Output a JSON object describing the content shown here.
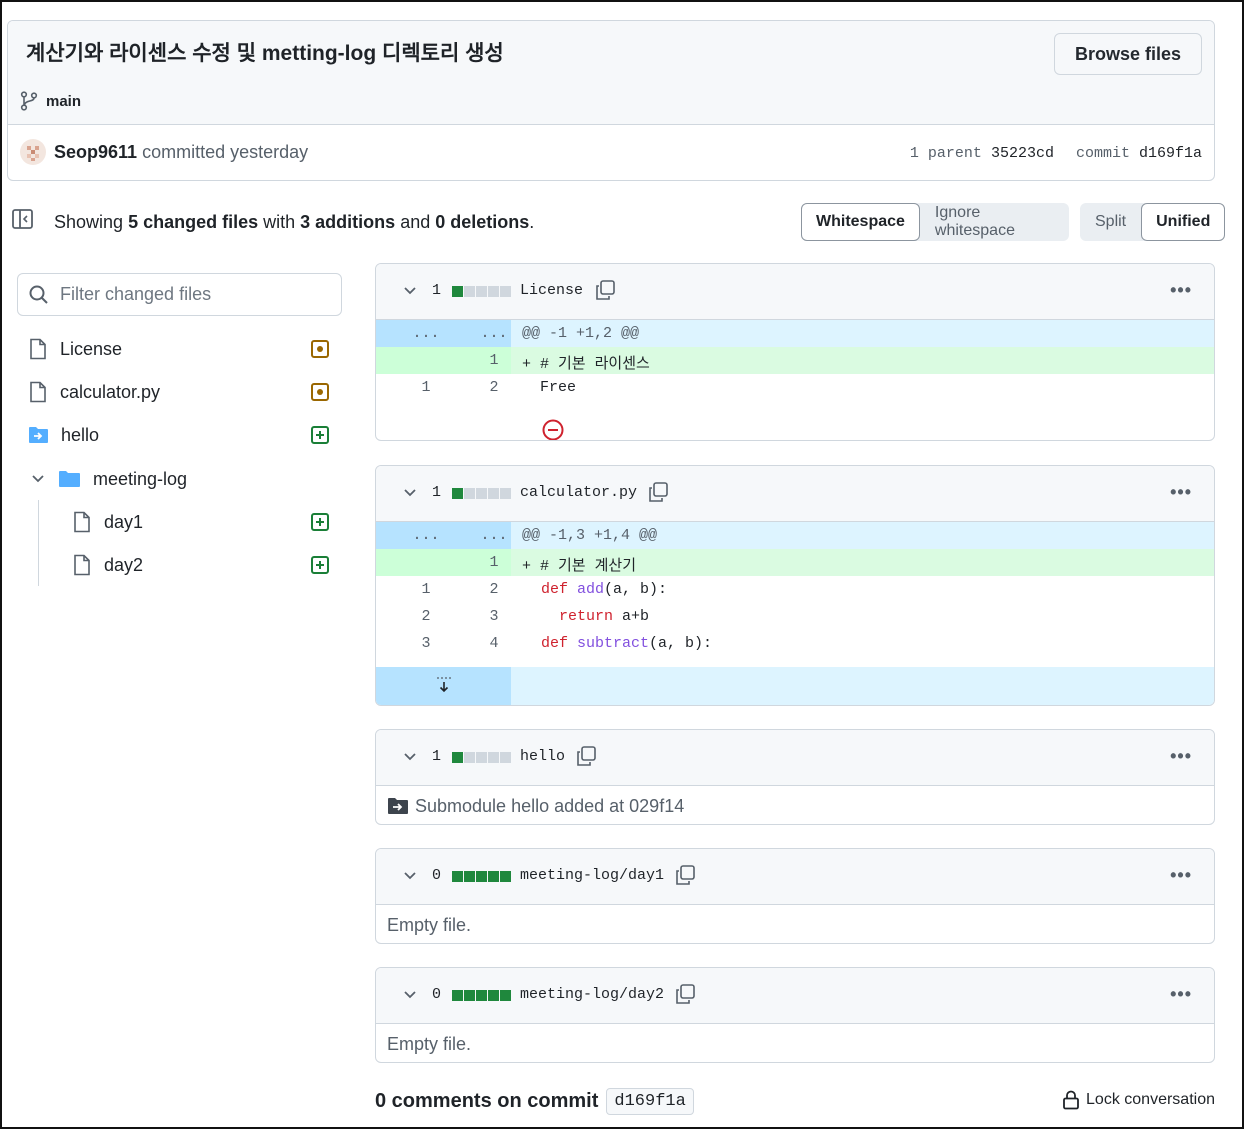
{
  "commit": {
    "title": "계산기와 라이센스 수정 및 metting-log 디렉토리 생성",
    "browse_label": "Browse files",
    "branch": "main",
    "author": "Seop9611",
    "action": "committed yesterday",
    "parent_label": "1 parent",
    "parent_sha": "35223cd",
    "commit_label": "commit",
    "commit_sha": "d169f1a"
  },
  "toolbar": {
    "showing": "Showing",
    "changed": "5 changed files",
    "with": "with",
    "additions": "3 additions",
    "and": "and",
    "deletions": "0 deletions",
    "period": ".",
    "whitespace": "Whitespace",
    "ignore_whitespace": "Ignore whitespace",
    "split": "Split",
    "unified": "Unified"
  },
  "tree": {
    "filter_placeholder": "Filter changed files",
    "items": [
      {
        "label": "License",
        "status": "modified"
      },
      {
        "label": "calculator.py",
        "status": "modified"
      },
      {
        "label": "hello",
        "status": "added"
      },
      {
        "label": "meeting-log",
        "status": "folder"
      },
      {
        "label": "day1",
        "status": "added"
      },
      {
        "label": "day2",
        "status": "added"
      }
    ]
  },
  "diffs": [
    {
      "count": "1",
      "name": "License",
      "lines": [
        {
          "type": "hunk",
          "a": "...",
          "b": "...",
          "code": "@@ -1 +1,2 @@"
        },
        {
          "type": "add",
          "a": "",
          "b": "1",
          "code": "+ # 기본 라이센스"
        },
        {
          "type": "ctx",
          "a": "1",
          "b": "2",
          "code": "  Free"
        }
      ]
    },
    {
      "count": "1",
      "name": "calculator.py",
      "lines": [
        {
          "type": "hunk",
          "a": "...",
          "b": "...",
          "code": "@@ -1,3 +1,4 @@"
        },
        {
          "type": "add",
          "a": "",
          "b": "1",
          "code": "+ # 기본 계산기"
        },
        {
          "type": "ctx",
          "a": "1",
          "b": "2",
          "kw": "def",
          "fn": "add",
          "rest": "(a, b):"
        },
        {
          "type": "ctx",
          "a": "2",
          "b": "3",
          "kw": "return",
          "rest": " a+b"
        },
        {
          "type": "ctx",
          "a": "3",
          "b": "4",
          "kw": "def",
          "fn": "subtract",
          "rest": "(a, b):"
        }
      ]
    },
    {
      "count": "1",
      "name": "hello",
      "note": "Submodule hello added at 029f14"
    },
    {
      "count": "0",
      "name": "meeting-log/day1",
      "note": "Empty file."
    },
    {
      "count": "0",
      "name": "meeting-log/day2",
      "note": "Empty file."
    }
  ],
  "footer": {
    "comments": "0 comments on commit",
    "sha": "d169f1a",
    "lock": "Lock conversation"
  },
  "colors": {
    "added": "#1f883d",
    "modified": "#9a6700",
    "hunk": "#ddf4ff",
    "addition_bg": "#dafbe1",
    "keyword": "#cf222e",
    "function": "#8250df"
  }
}
